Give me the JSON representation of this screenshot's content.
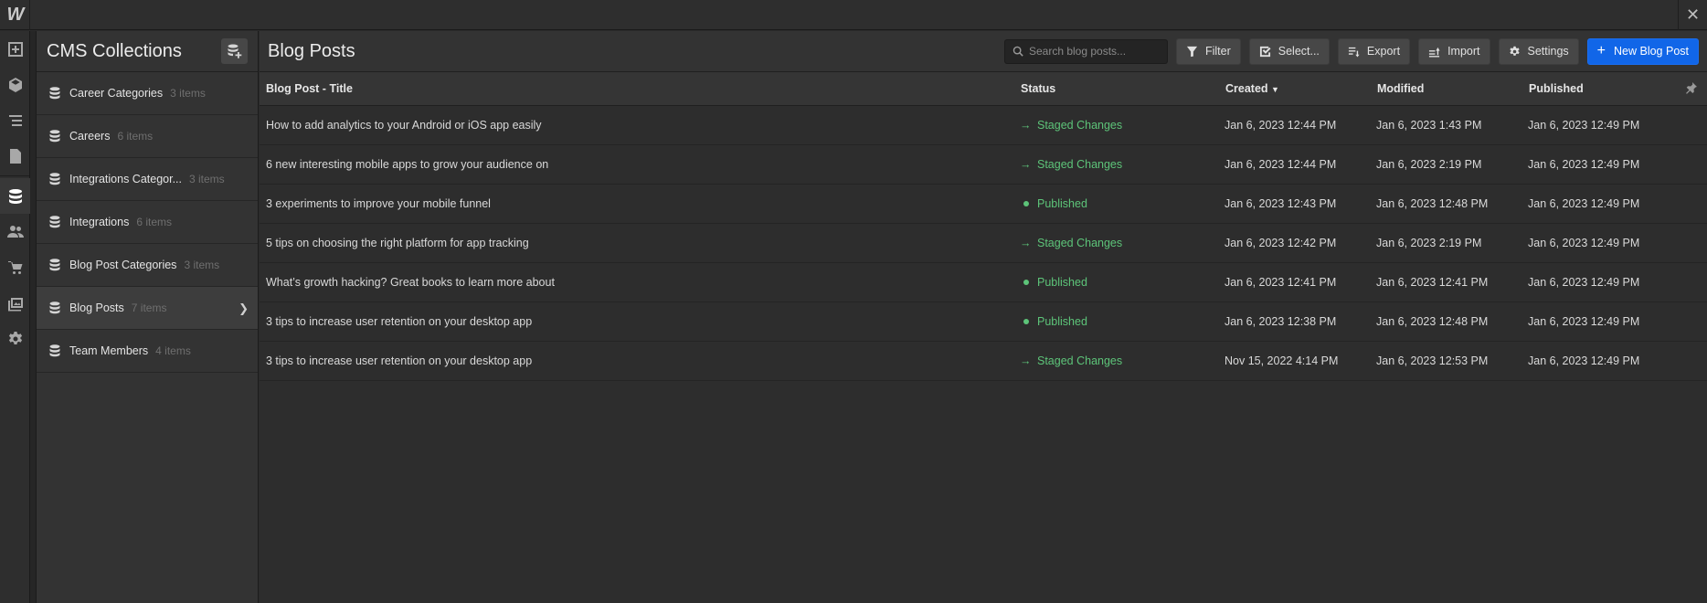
{
  "app": {
    "logo_letter": "W",
    "close_glyph": "✕"
  },
  "rail": {
    "items": [
      {
        "name": "add-elements-icon"
      },
      {
        "name": "components-icon"
      },
      {
        "name": "navigator-icon"
      },
      {
        "name": "pages-icon"
      },
      {
        "name": "cms-icon",
        "active": true
      },
      {
        "name": "users-icon"
      },
      {
        "name": "ecommerce-icon"
      },
      {
        "name": "assets-icon"
      },
      {
        "name": "settings-icon"
      }
    ]
  },
  "collections": {
    "title": "CMS Collections",
    "items": [
      {
        "label": "Career Categories",
        "count": "3 items"
      },
      {
        "label": "Careers",
        "count": "6 items"
      },
      {
        "label": "Integrations Categor...",
        "count": "3 items"
      },
      {
        "label": "Integrations",
        "count": "6 items"
      },
      {
        "label": "Blog Post Categories",
        "count": "3 items"
      },
      {
        "label": "Blog Posts",
        "count": "7 items",
        "active": true
      },
      {
        "label": "Team Members",
        "count": "4 items"
      }
    ]
  },
  "main": {
    "title": "Blog Posts",
    "search_placeholder": "Search blog posts...",
    "toolbar": {
      "filter": "Filter",
      "select": "Select...",
      "export": "Export",
      "import": "Import",
      "settings": "Settings",
      "new_post": "New Blog Post"
    },
    "columns": {
      "title": "Blog Post - Title",
      "status": "Status",
      "created": "Created",
      "modified": "Modified",
      "published": "Published"
    },
    "rows": [
      {
        "title": "How to add analytics to your Android or iOS app easily",
        "status": "Staged Changes",
        "created": "Jan 6, 2023 12:44 PM",
        "modified": "Jan 6, 2023 1:43 PM",
        "published": "Jan 6, 2023 12:49 PM"
      },
      {
        "title": "6 new interesting mobile apps to grow your audience on",
        "status": "Staged Changes",
        "created": "Jan 6, 2023 12:44 PM",
        "modified": "Jan 6, 2023 2:19 PM",
        "published": "Jan 6, 2023 12:49 PM"
      },
      {
        "title": "3 experiments to improve your mobile funnel",
        "status": "Published",
        "created": "Jan 6, 2023 12:43 PM",
        "modified": "Jan 6, 2023 12:48 PM",
        "published": "Jan 6, 2023 12:49 PM"
      },
      {
        "title": "5 tips on choosing the right platform for app tracking",
        "status": "Staged Changes",
        "created": "Jan 6, 2023 12:42 PM",
        "modified": "Jan 6, 2023 2:19 PM",
        "published": "Jan 6, 2023 12:49 PM"
      },
      {
        "title": "What’s growth hacking? Great books to learn more about",
        "status": "Published",
        "created": "Jan 6, 2023 12:41 PM",
        "modified": "Jan 6, 2023 12:41 PM",
        "published": "Jan 6, 2023 12:49 PM"
      },
      {
        "title": "3 tips to increase user retention on your desktop app",
        "status": "Published",
        "created": "Jan 6, 2023 12:38 PM",
        "modified": "Jan 6, 2023 12:48 PM",
        "published": "Jan 6, 2023 12:49 PM"
      },
      {
        "title": "3 tips to increase user retention on your desktop app",
        "status": "Staged Changes",
        "created": "Nov 15, 2022 4:14 PM",
        "modified": "Jan 6, 2023 12:53 PM",
        "published": "Jan 6, 2023 12:49 PM"
      }
    ]
  },
  "colors": {
    "accent": "#1166e8",
    "status_green": "#5dc479",
    "background": "#2d2d2d"
  }
}
